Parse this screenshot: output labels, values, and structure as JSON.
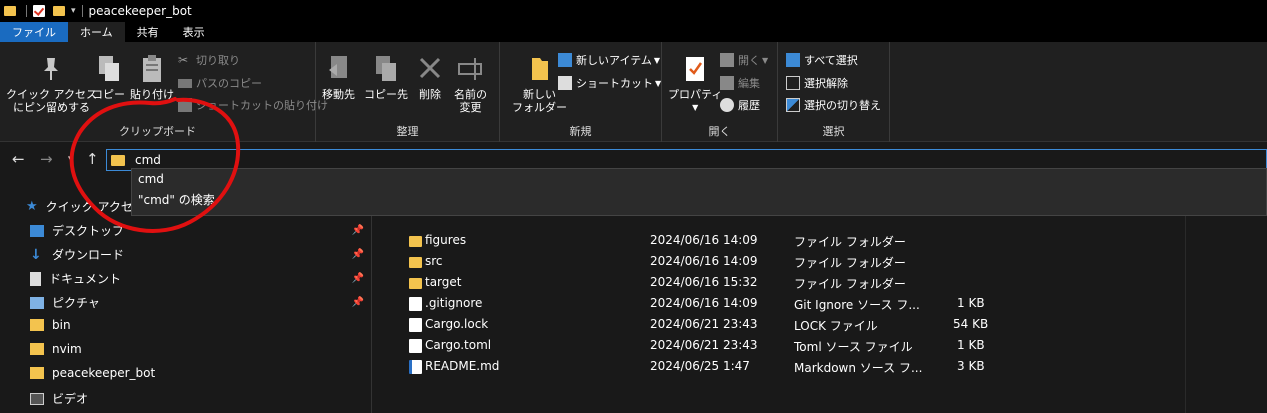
{
  "window": {
    "title": "peacekeeper_bot"
  },
  "tabs": [
    "ファイル",
    "ホーム",
    "共有",
    "表示"
  ],
  "ribbon": {
    "clipboard": {
      "pin_label_1": "クイック アクセス",
      "pin_label_2": "にピン留めする",
      "copy": "コピー",
      "paste": "貼り付け",
      "cut": "切り取り",
      "copy_path": "パスのコピー",
      "paste_shortcut": "ショートカットの貼り付け",
      "group": "クリップボード"
    },
    "organize": {
      "move_to": "移動先",
      "copy_to": "コピー先",
      "delete": "削除",
      "rename_1": "名前の",
      "rename_2": "変更",
      "group": "整理"
    },
    "new": {
      "new_folder_1": "新しい",
      "new_folder_2": "フォルダー",
      "new_item": "新しいアイテム",
      "shortcut": "ショートカット",
      "group": "新規"
    },
    "open": {
      "properties": "プロパティ",
      "open": "開く",
      "edit": "編集",
      "history": "履歴",
      "group": "開く"
    },
    "select": {
      "select_all": "すべて選択",
      "select_none": "選択解除",
      "invert": "選択の切り替え",
      "group": "選択"
    }
  },
  "address": {
    "value": "cmd",
    "suggestions": [
      "cmd",
      "\"cmd\" の検索"
    ]
  },
  "navpane": {
    "items": [
      {
        "label": "クイック アクセス",
        "icon": "star-icon",
        "pinned": false
      },
      {
        "label": "デスクトップ",
        "icon": "desktop-icon",
        "pinned": true
      },
      {
        "label": "ダウンロード",
        "icon": "download-icon",
        "pinned": true
      },
      {
        "label": "ドキュメント",
        "icon": "document-icon",
        "pinned": true
      },
      {
        "label": "ピクチャ",
        "icon": "picture-icon",
        "pinned": true
      },
      {
        "label": "bin",
        "icon": "folder-icon",
        "pinned": false
      },
      {
        "label": "nvim",
        "icon": "folder-icon",
        "pinned": false
      },
      {
        "label": "peacekeeper_bot",
        "icon": "folder-icon",
        "pinned": false
      },
      {
        "label": "ビデオ",
        "icon": "video-icon",
        "pinned": false
      }
    ]
  },
  "files": [
    {
      "name": "figures",
      "date": "2024/06/16 14:09",
      "type": "ファイル フォルダー",
      "size": "",
      "icon": "folder-icon"
    },
    {
      "name": "src",
      "date": "2024/06/16 14:09",
      "type": "ファイル フォルダー",
      "size": "",
      "icon": "folder-icon"
    },
    {
      "name": "target",
      "date": "2024/06/16 15:32",
      "type": "ファイル フォルダー",
      "size": "",
      "icon": "folder-icon"
    },
    {
      "name": ".gitignore",
      "date": "2024/06/16 14:09",
      "type": "Git Ignore ソース フ...",
      "size": "1 KB",
      "icon": "gear-file-icon"
    },
    {
      "name": "Cargo.lock",
      "date": "2024/06/21 23:43",
      "type": "LOCK ファイル",
      "size": "54 KB",
      "icon": "file-icon"
    },
    {
      "name": "Cargo.toml",
      "date": "2024/06/21 23:43",
      "type": "Toml ソース ファイル",
      "size": "1 KB",
      "icon": "file-icon"
    },
    {
      "name": "README.md",
      "date": "2024/06/25 1:47",
      "type": "Markdown ソース フ...",
      "size": "3 KB",
      "icon": "markdown-file-icon"
    }
  ],
  "colors": {
    "accent": "#1a6bc0",
    "annotation": "#e01010",
    "folder": "#f3c34e"
  }
}
